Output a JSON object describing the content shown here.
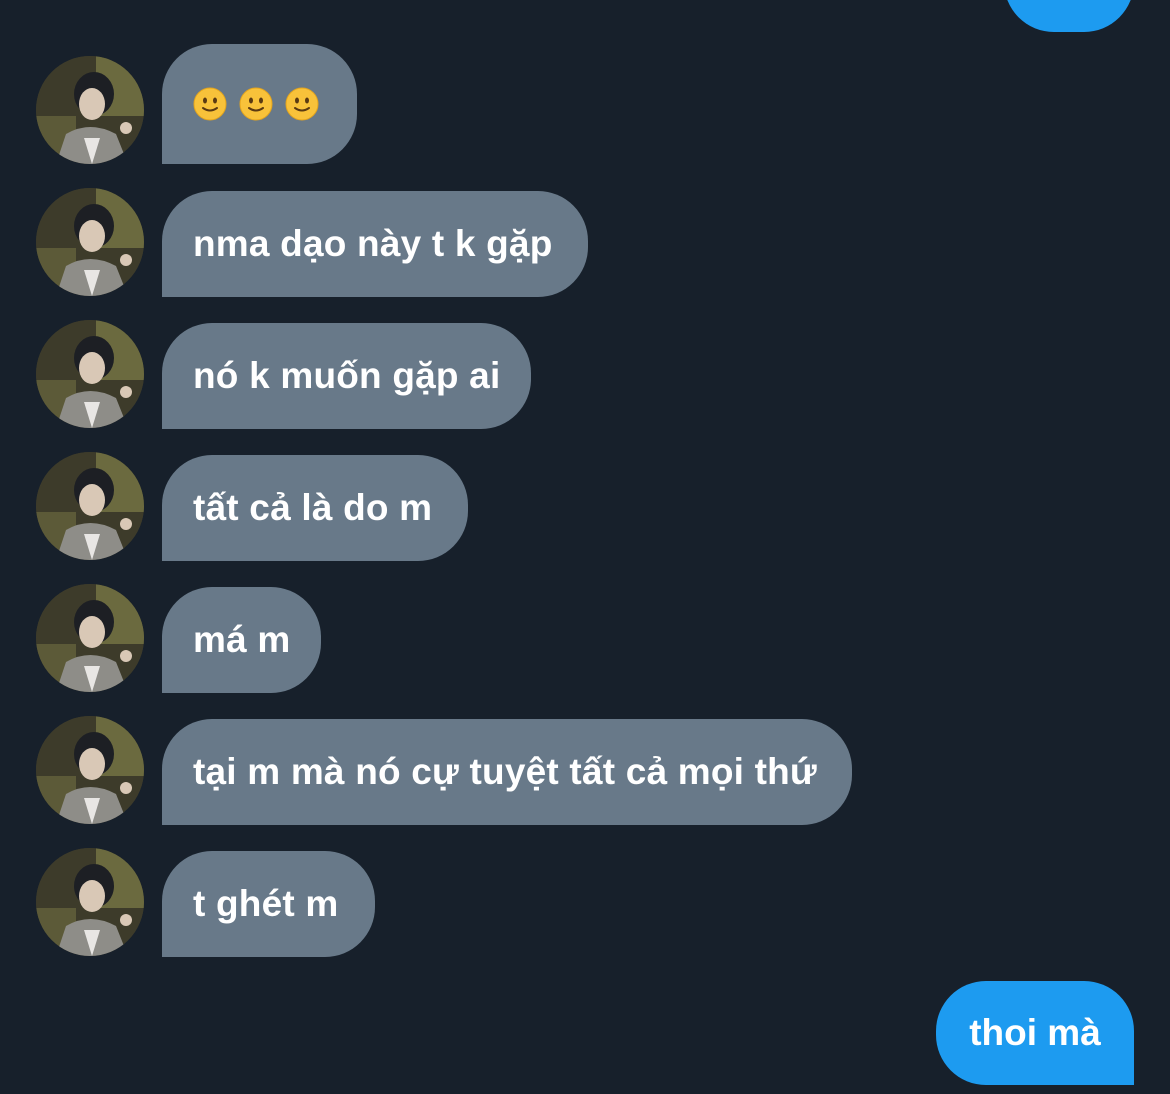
{
  "conversation": {
    "incoming": [
      {
        "type": "emoji",
        "emojis": [
          "slightly-smiling-face",
          "slightly-smiling-face",
          "slightly-smiling-face"
        ]
      },
      {
        "type": "text",
        "text": "nma dạo này t k gặp"
      },
      {
        "type": "text",
        "text": "nó k muốn gặp ai"
      },
      {
        "type": "text",
        "text": "tất cả là do m"
      },
      {
        "type": "text",
        "text": "má m"
      },
      {
        "type": "text",
        "text": "tại m mà nó cự tuyệt tất cả mọi thứ"
      },
      {
        "type": "text",
        "text": "t ghét m"
      }
    ],
    "outgoing": [
      {
        "text": "thoi mà"
      }
    ]
  },
  "colors": {
    "background": "#17202b",
    "incoming_bubble": "#687989",
    "outgoing_bubble": "#1d9bf0",
    "text": "#ffffff"
  },
  "icons": {
    "avatar": "contact-avatar-photo",
    "emoji": "slightly-smiling-face-emoji"
  }
}
